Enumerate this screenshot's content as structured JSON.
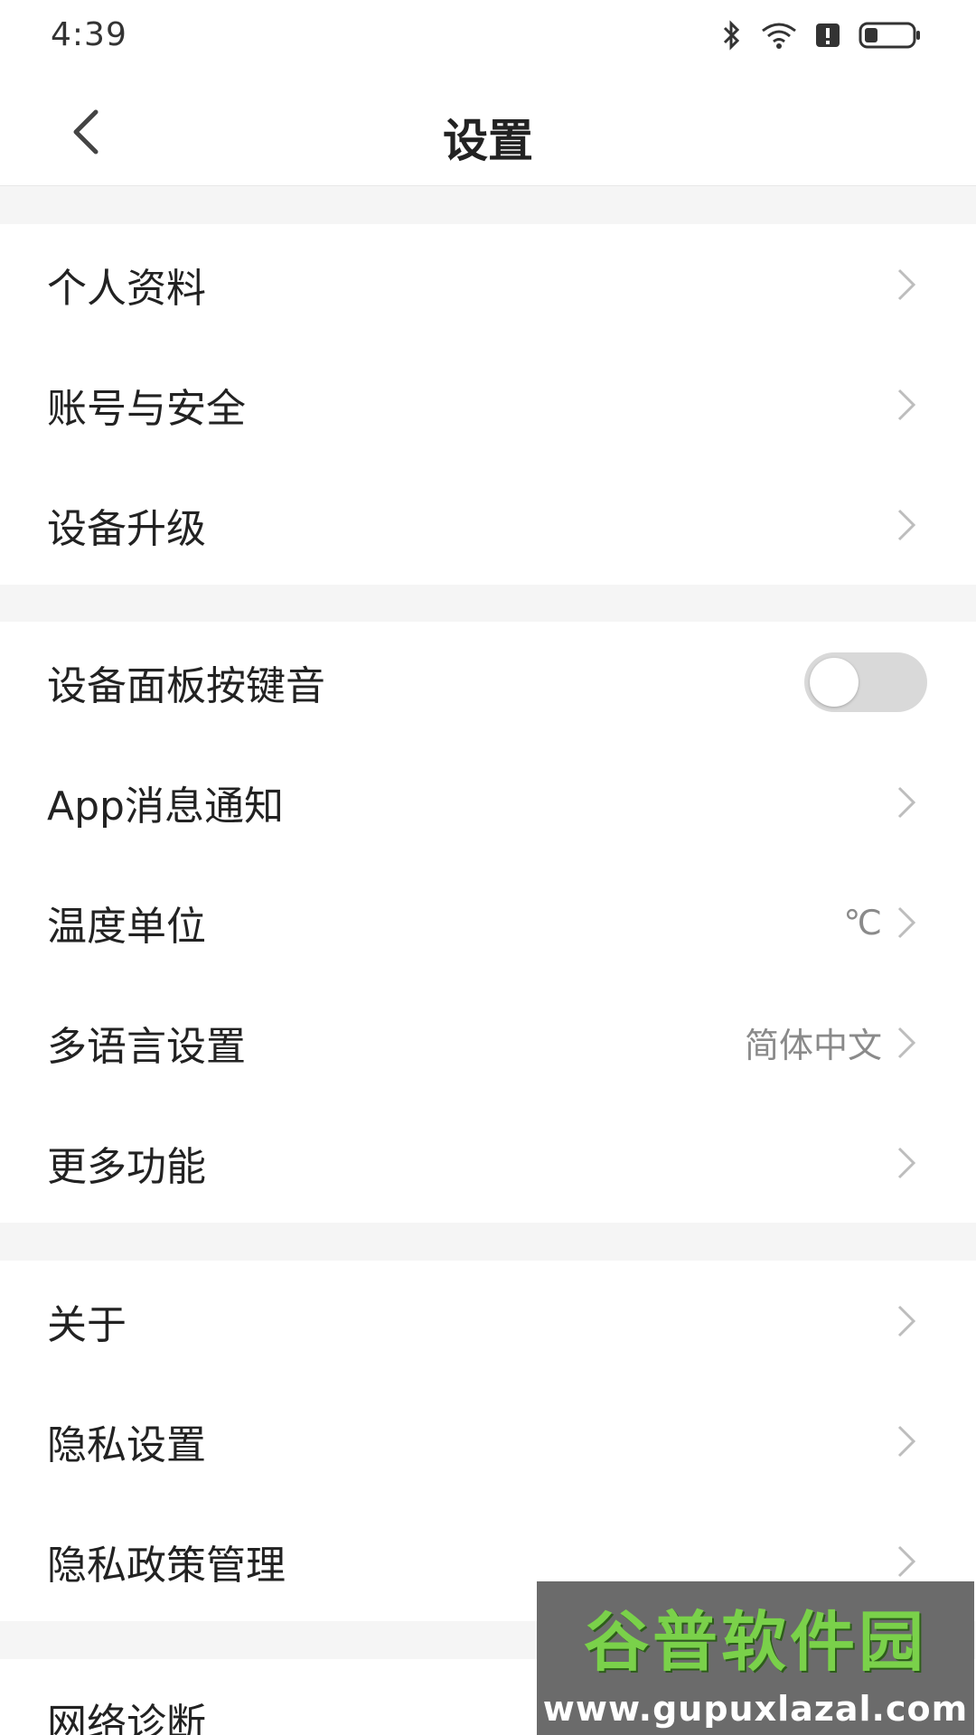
{
  "status": {
    "time": "4:39",
    "icons": [
      "bluetooth-icon",
      "wifi-icon",
      "alert-icon",
      "battery-icon"
    ]
  },
  "header": {
    "title": "设置",
    "back_icon": "chevron-left-icon"
  },
  "groups": [
    {
      "items": [
        {
          "label": "个人资料"
        },
        {
          "label": "账号与安全"
        },
        {
          "label": "设备升级"
        }
      ]
    },
    {
      "items": [
        {
          "label": "设备面板按键音",
          "toggle": false
        },
        {
          "label": "App消息通知"
        },
        {
          "label": "温度单位",
          "value": "℃"
        },
        {
          "label": "多语言设置",
          "value": "简体中文"
        },
        {
          "label": "更多功能"
        }
      ]
    },
    {
      "items": [
        {
          "label": "关于"
        },
        {
          "label": "隐私设置"
        },
        {
          "label": "隐私政策管理"
        }
      ]
    },
    {
      "items": [
        {
          "label": "网络诊断"
        }
      ]
    }
  ],
  "watermark": {
    "text": "谷普软件园",
    "url": "www.gupuxlazal.com"
  },
  "colors": {
    "background": "#f5f5f5",
    "card": "#ffffff",
    "toggle_off": "#d9d9d9",
    "muted": "#8a8a8a"
  }
}
